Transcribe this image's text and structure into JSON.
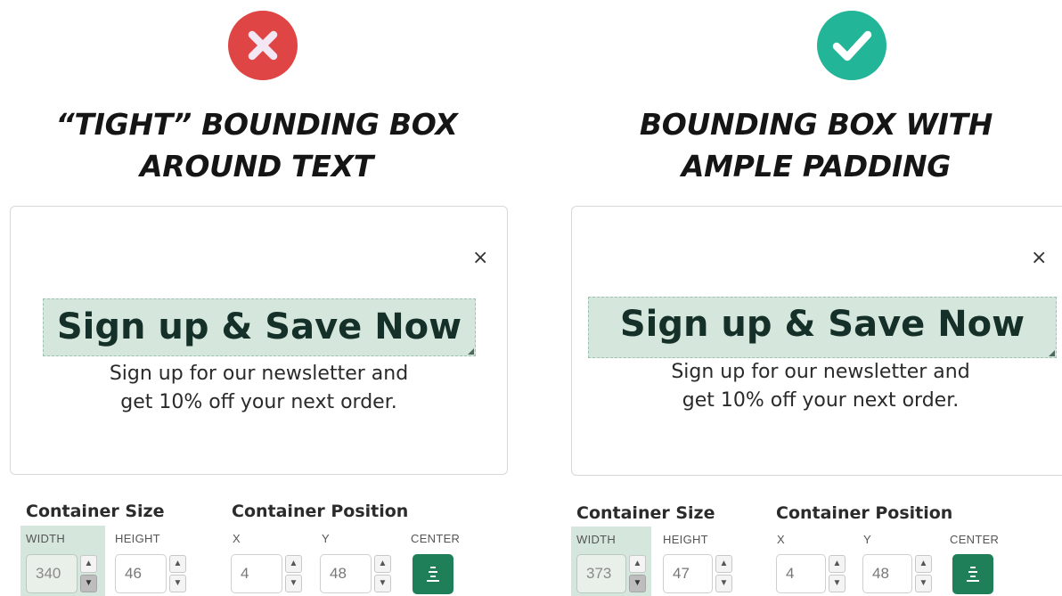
{
  "left": {
    "status_icon": "x-circle-icon",
    "status_color": "#e04545",
    "heading_line1": "“TIGHT” BOUNDING BOX",
    "heading_line2": "AROUND TEXT",
    "card": {
      "close_icon": "close-icon",
      "close": "×",
      "headline": "Sign up & Save Now",
      "sub_line1": "Sign up for our newsletter and",
      "sub_line2": "get 10% off your next order."
    },
    "controls": {
      "size_title": "Container Size",
      "position_title": "Container Position",
      "width_label": "WIDTH",
      "height_label": "HEIGHT",
      "x_label": "X",
      "y_label": "Y",
      "center_label": "CENTER",
      "width_value": "340",
      "height_value": "46",
      "x_value": "4",
      "y_value": "48"
    }
  },
  "right": {
    "status_icon": "check-circle-icon",
    "status_color": "#23b597",
    "heading_line1": "BOUNDING BOX WITH",
    "heading_line2": "AMPLE PADDING",
    "card": {
      "close_icon": "close-icon",
      "close": "×",
      "headline": "Sign up & Save Now",
      "sub_line1": "Sign up for our newsletter and",
      "sub_line2": "get 10% off your next order."
    },
    "controls": {
      "size_title": "Container Size",
      "position_title": "Container Position",
      "width_label": "WIDTH",
      "height_label": "HEIGHT",
      "x_label": "X",
      "y_label": "Y",
      "center_label": "CENTER",
      "width_value": "373",
      "height_value": "47",
      "x_value": "4",
      "y_value": "48"
    }
  },
  "stepper_up": "▲",
  "stepper_down": "▼",
  "accent_color": "#1f7f58",
  "highlight_color": "#d5e6dd"
}
